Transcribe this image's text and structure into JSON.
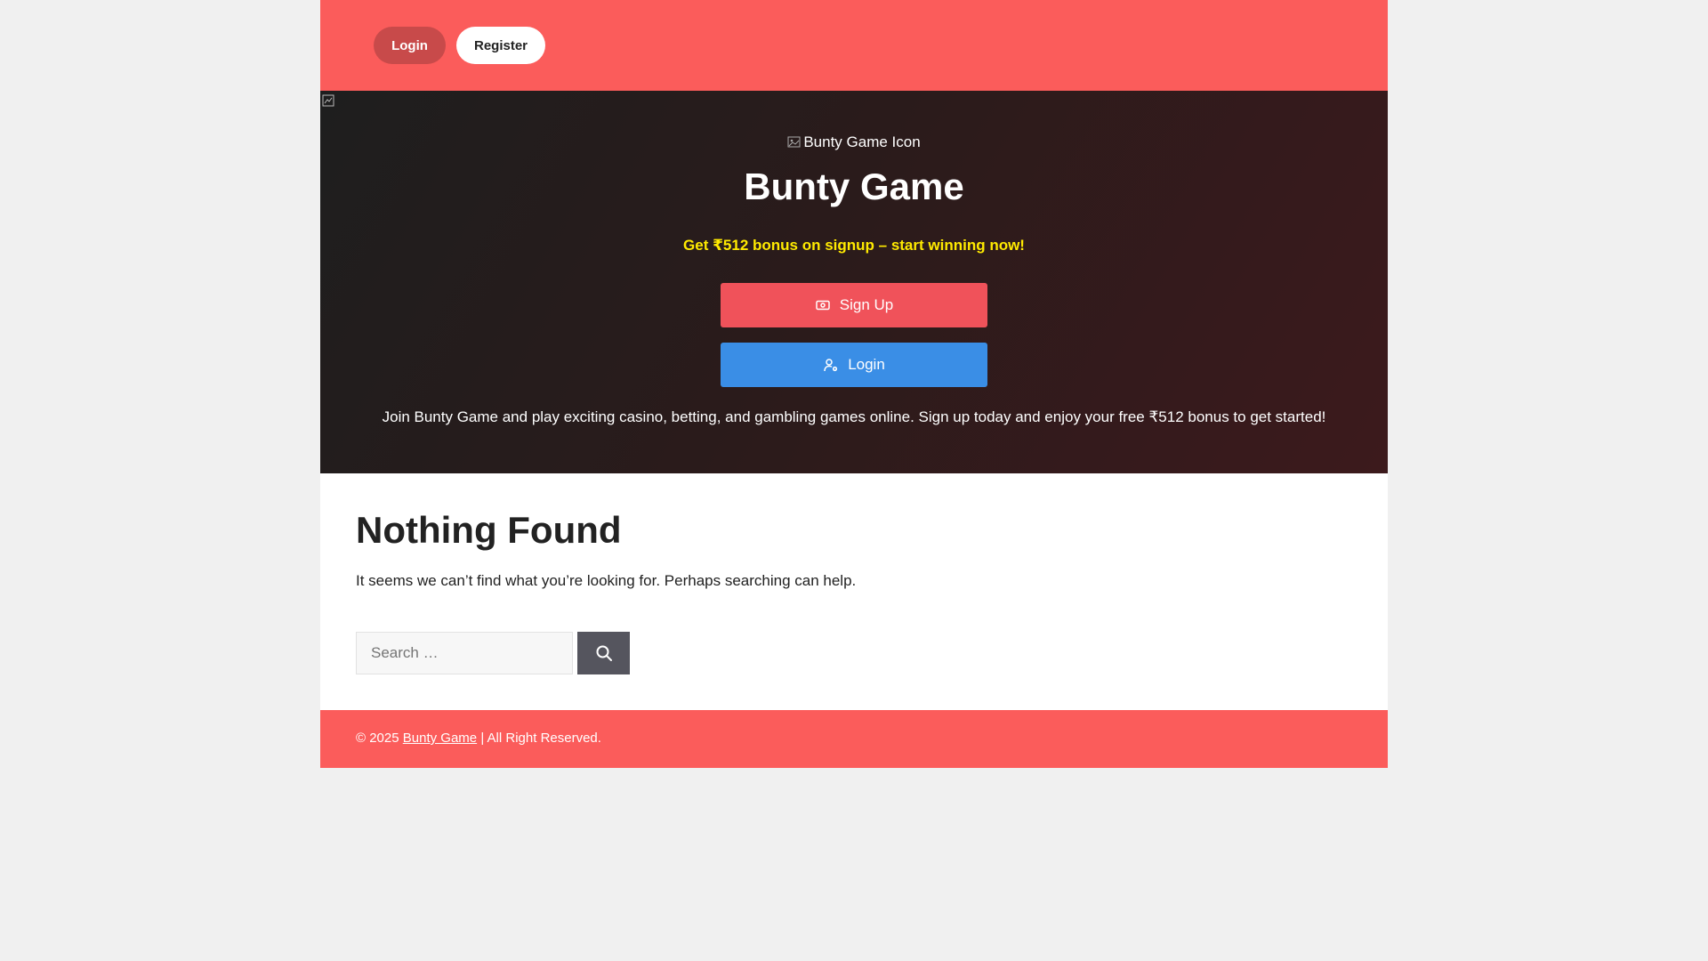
{
  "header": {
    "login_label": "Login",
    "register_label": "Register"
  },
  "hero": {
    "icon_alt": "Bunty Game Icon",
    "title": "Bunty Game",
    "bonus_text": "Get ₹512 bonus on signup – start winning now!",
    "signup_label": "Sign Up",
    "login_label": "Login",
    "description": "Join Bunty Game and play exciting casino, betting, and gambling games online. Sign up today and enjoy your free ₹512 bonus to get started!",
    "signup_icon": "cash-icon",
    "login_icon": "user-settings-icon"
  },
  "main": {
    "title": "Nothing Found",
    "message": "It seems we can’t find what you’re looking for. Perhaps searching can help.",
    "search": {
      "placeholder": "Search …",
      "value": "",
      "button_icon": "search-icon"
    }
  },
  "footer": {
    "copyright_prefix": "© 2025",
    "site_link": "Bunty Game",
    "rights_suffix": "| All Right Reserved."
  },
  "colors": {
    "brand_red": "#fb5c5b",
    "login_pill": "#c84a4a",
    "signup_button": "#f0525a",
    "login_button": "#3a8ee6",
    "bonus_yellow": "#ffea00",
    "search_button": "#55555e"
  }
}
